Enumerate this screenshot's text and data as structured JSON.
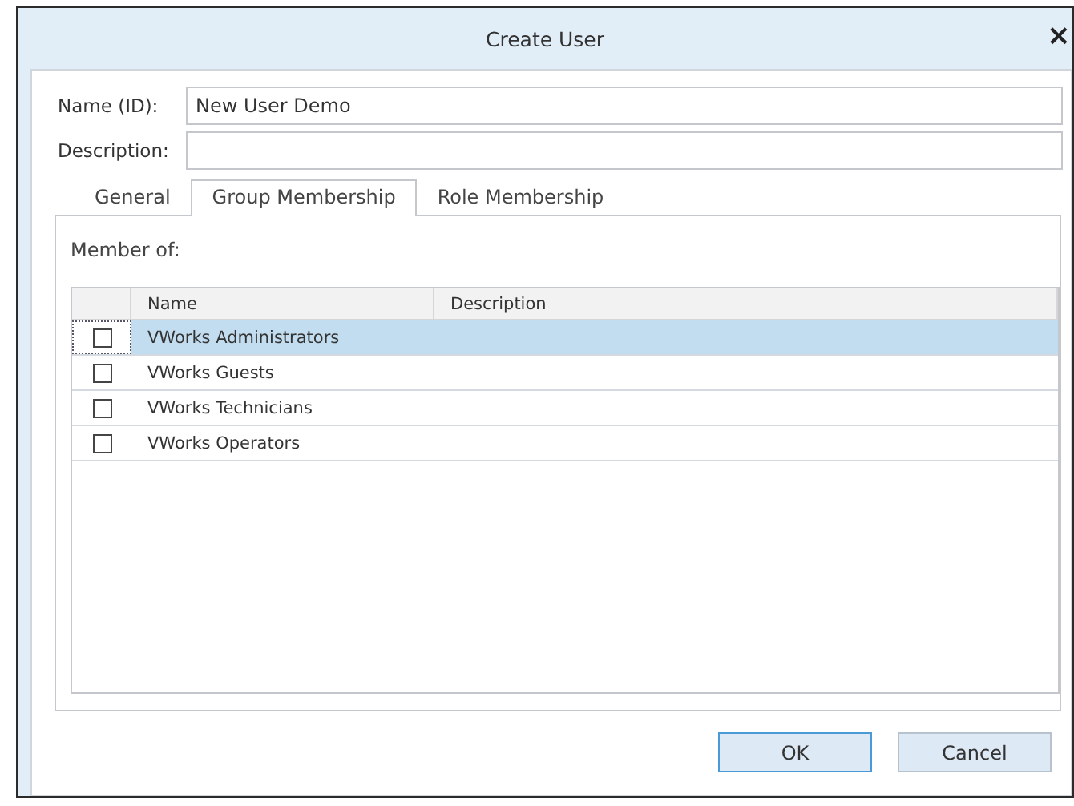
{
  "window": {
    "title": "Create User",
    "close": "×"
  },
  "fields": [
    {
      "label": "Name (ID):",
      "value": "New User Demo"
    },
    {
      "label": "Description:"
    }
  ],
  "tabs": [
    {
      "label": "General",
      "selected": false
    },
    {
      "label": "Group Membership",
      "selected": true
    },
    {
      "label": "Role Membership",
      "selected": false
    }
  ],
  "member_label": "Member of:",
  "table": {
    "columns": [
      "Name",
      "Description"
    ],
    "rows": [
      {
        "name": "VWorks Administrators",
        "checked": false,
        "selected": true
      },
      {
        "name": "VWorks Guests",
        "checked": false,
        "selected": false
      },
      {
        "name": "VWorks Technicians",
        "checked": false,
        "selected": false
      },
      {
        "name": "VWorks Operators",
        "checked": false,
        "selected": false
      }
    ]
  },
  "buttons": [
    {
      "label": "OK",
      "default": true
    },
    {
      "label": "Cancel",
      "default": false
    }
  ]
}
